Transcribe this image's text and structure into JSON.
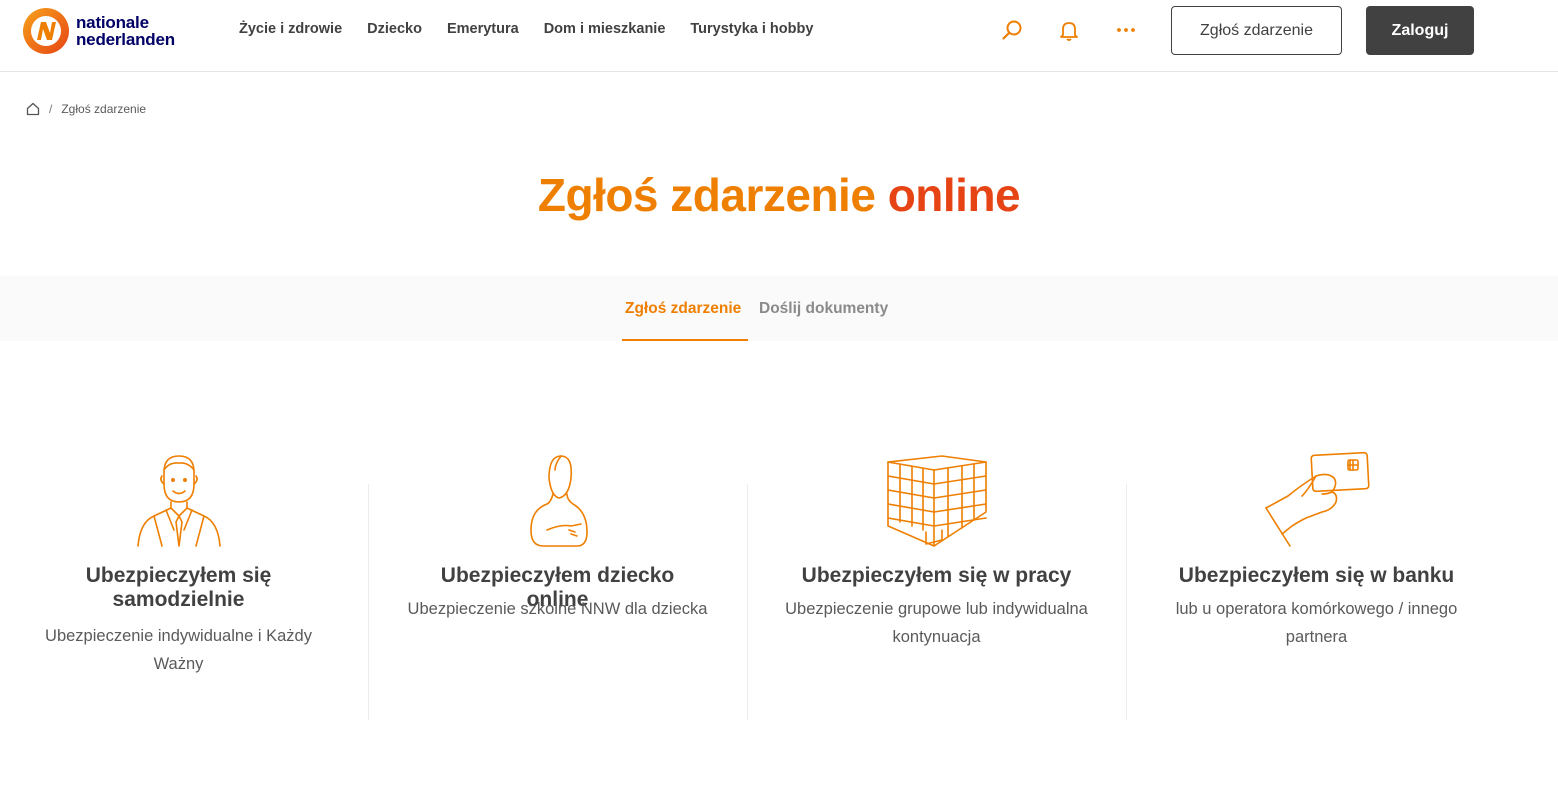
{
  "brand": {
    "line1": "nationale",
    "line2": "nederlanden",
    "primary_color": "#ee7f00",
    "secondary_color": "#e64415",
    "text_color": "#414141"
  },
  "nav": {
    "items": [
      {
        "label": "Życie i zdrowie"
      },
      {
        "label": "Dziecko"
      },
      {
        "label": "Emerytura"
      },
      {
        "label": "Dom i mieszkanie"
      },
      {
        "label": "Turystyka i hobby"
      }
    ],
    "icons": [
      "search-icon",
      "bell-icon",
      "more-icon"
    ],
    "report_button": "Zgłoś zdarzenie",
    "login_button": "Zaloguj"
  },
  "breadcrumb": {
    "home_icon": "home-icon",
    "separator": "/",
    "current": "Zgłoś zdarzenie"
  },
  "page": {
    "title_part1": "Zgłoś zdarzenie",
    "title_part2": "online"
  },
  "tabs": [
    {
      "label": "Zgłoś zdarzenie",
      "active": true
    },
    {
      "label": "Doślij dokumenty",
      "active": false
    }
  ],
  "cards": [
    {
      "icon": "businessman-icon",
      "title": "Ubezpieczyłem się samodzielnie",
      "description": "Ubezpieczenie indywidualne i Każdy Ważny"
    },
    {
      "icon": "child-icon",
      "title": "Ubezpieczyłem dziecko online",
      "description": "Ubezpieczenie szkolne NNW dla dziecka"
    },
    {
      "icon": "office-building-icon",
      "title": "Ubezpieczyłem się w pracy",
      "description": "Ubezpieczenie grupowe lub indywidualna kontynuacja"
    },
    {
      "icon": "hand-card-icon",
      "title": "Ubezpieczyłem się w banku",
      "description": "lub u operatora komórkowego / innego partnera"
    }
  ]
}
